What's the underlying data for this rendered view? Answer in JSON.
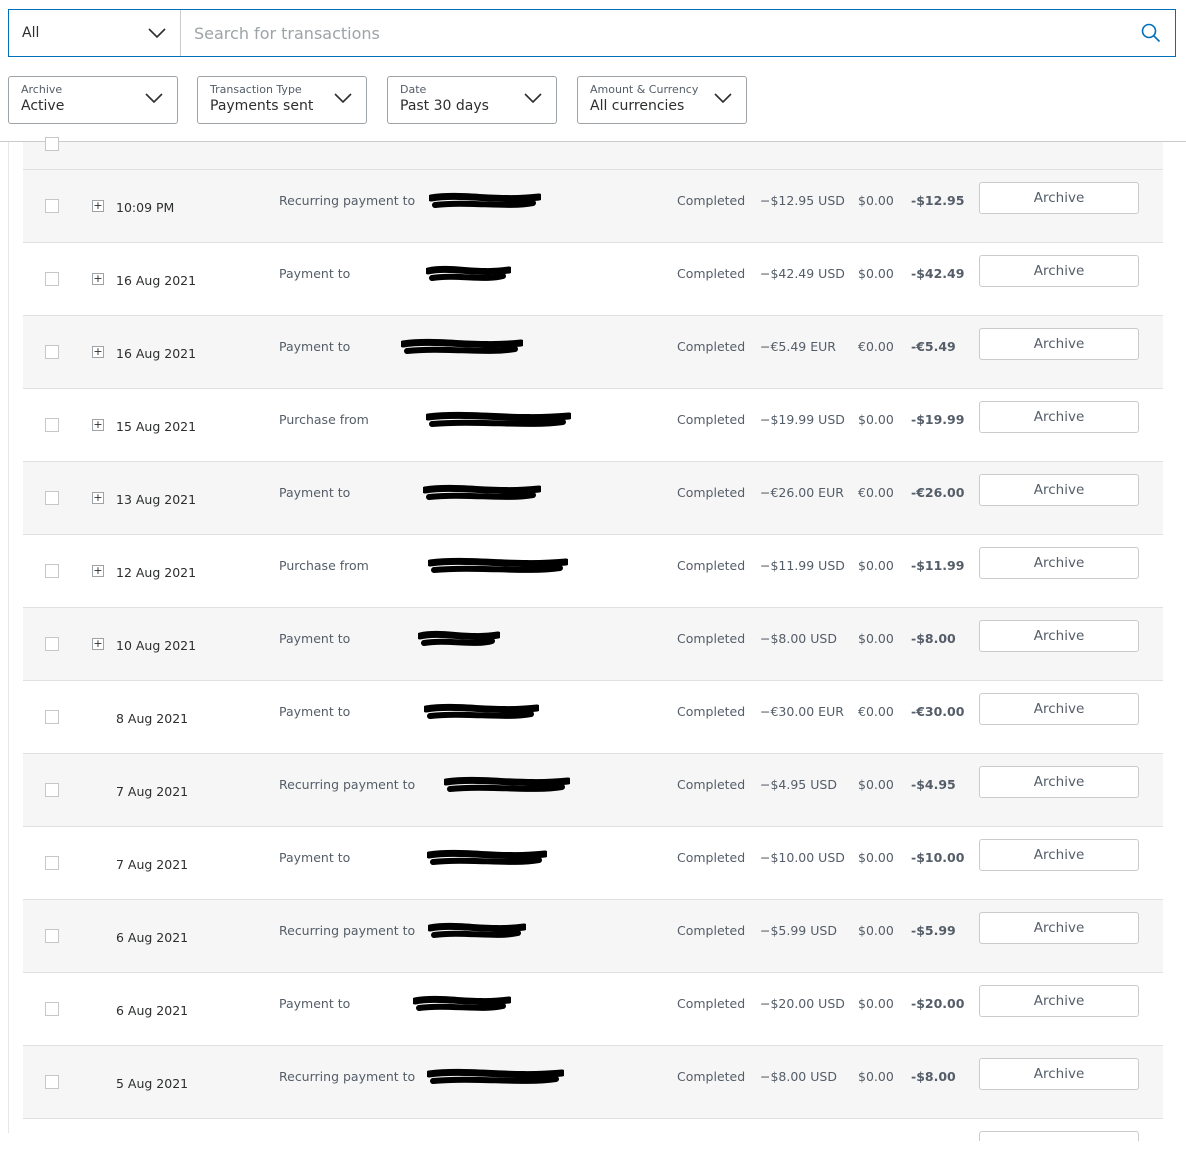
{
  "search": {
    "scope_value": "All",
    "placeholder": "Search for transactions"
  },
  "filters": [
    {
      "label": "Archive",
      "value": "Active"
    },
    {
      "label": "Transaction Type",
      "value": "Payments sent"
    },
    {
      "label": "Date",
      "value": "Past 30 days"
    },
    {
      "label": "Amount & Currency",
      "value": "All currencies"
    }
  ],
  "archive_label": "Archive",
  "transactions": [
    {
      "date": "10:09 PM",
      "description": "Recurring payment to",
      "status": "Completed",
      "gross": "−$12.95 USD",
      "fee": "$0.00",
      "net": "-$12.95",
      "expandable": true
    },
    {
      "date": "16 Aug 2021",
      "description": "Payment to",
      "status": "Completed",
      "gross": "−$42.49 USD",
      "fee": "$0.00",
      "net": "-$42.49",
      "expandable": true
    },
    {
      "date": "16 Aug 2021",
      "description": "Payment to",
      "status": "Completed",
      "gross": "−€5.49 EUR",
      "fee": "€0.00",
      "net": "-€5.49",
      "expandable": true
    },
    {
      "date": "15 Aug 2021",
      "description": "Purchase from",
      "status": "Completed",
      "gross": "−$19.99 USD",
      "fee": "$0.00",
      "net": "-$19.99",
      "expandable": true
    },
    {
      "date": "13 Aug 2021",
      "description": "Payment to",
      "status": "Completed",
      "gross": "−€26.00 EUR",
      "fee": "€0.00",
      "net": "-€26.00",
      "expandable": true
    },
    {
      "date": "12 Aug 2021",
      "description": "Purchase from",
      "status": "Completed",
      "gross": "−$11.99 USD",
      "fee": "$0.00",
      "net": "-$11.99",
      "expandable": true
    },
    {
      "date": "10 Aug 2021",
      "description": "Payment to",
      "status": "Completed",
      "gross": "−$8.00 USD",
      "fee": "$0.00",
      "net": "-$8.00",
      "expandable": true
    },
    {
      "date": "8 Aug 2021",
      "description": "Payment to",
      "status": "Completed",
      "gross": "−€30.00 EUR",
      "fee": "€0.00",
      "net": "-€30.00",
      "expandable": false
    },
    {
      "date": "7 Aug 2021",
      "description": "Recurring payment to",
      "status": "Completed",
      "gross": "−$4.95 USD",
      "fee": "$0.00",
      "net": "-$4.95",
      "expandable": false
    },
    {
      "date": "7 Aug 2021",
      "description": "Payment to",
      "status": "Completed",
      "gross": "−$10.00 USD",
      "fee": "$0.00",
      "net": "-$10.00",
      "expandable": false
    },
    {
      "date": "6 Aug 2021",
      "description": "Recurring payment to",
      "status": "Completed",
      "gross": "−$5.99 USD",
      "fee": "$0.00",
      "net": "-$5.99",
      "expandable": false
    },
    {
      "date": "6 Aug 2021",
      "description": "Payment to",
      "status": "Completed",
      "gross": "−$20.00 USD",
      "fee": "$0.00",
      "net": "-$20.00",
      "expandable": false
    },
    {
      "date": "5 Aug 2021",
      "description": "Recurring payment to",
      "status": "Completed",
      "gross": "−$8.00 USD",
      "fee": "$0.00",
      "net": "-$8.00",
      "expandable": false
    }
  ]
}
